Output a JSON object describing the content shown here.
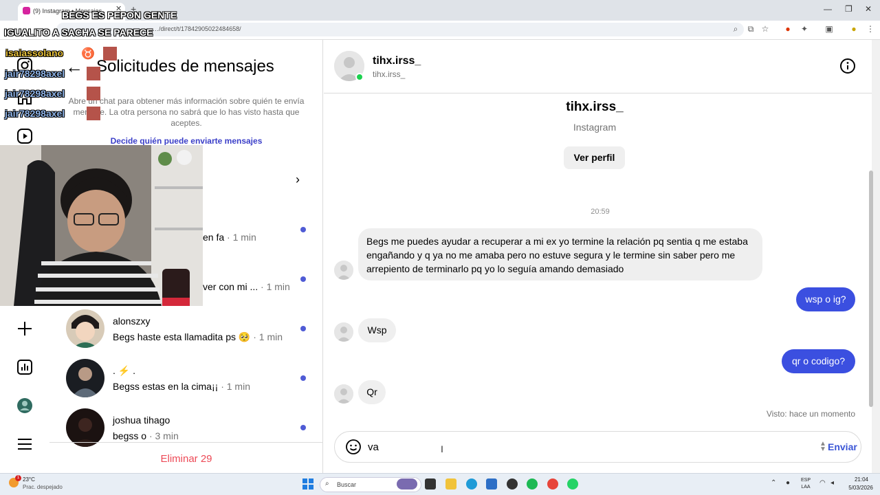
{
  "browser": {
    "tab_title": "(9) Instagram • Mensajes",
    "url": "…/direct/t/17842905022484658/"
  },
  "overlay": {
    "chat_line_1": "BEGS ES PEPON GENTE",
    "chat_line_2": "IGUALITO A SACHA SE PARECE",
    "chat_user_1": "isaiassolano",
    "chat_user_2": "jair78298axel",
    "chat_user_3": "jair78298axel",
    "chat_user_4": "jair78298axel"
  },
  "left_panel": {
    "title": "Solicitudes de mensajes",
    "info_text": "Abre un chat para obtener más información sobre quién te envía mensaje. La otra persona no sabrá que lo has visto hasta que aceptes.",
    "decide_link": "Decide quién puede enviarte mensajes",
    "partial_1": {
      "text": "en fa",
      "time": "· 1 min"
    },
    "partial_2": {
      "text": "ver con mi ...",
      "time": "· 1 min"
    },
    "requests": [
      {
        "username": "alonszxy",
        "preview": "Begs haste esta llamadita ps 🥺",
        "time": "· 1 min"
      },
      {
        "username": ". ⚡ .",
        "preview": "Begss estas en la cima¡¡",
        "time": "· 1 min"
      },
      {
        "username": "joshua tihago",
        "preview": "begss o",
        "time": "· 3 min"
      }
    ],
    "delete_label": "Eliminar 29"
  },
  "chat": {
    "header_name": "tihx.irss_",
    "header_user": "tihx.irss_",
    "profile_name": "tihx.irss_",
    "profile_sub": "Instagram",
    "view_profile": "Ver perfil",
    "timestamp": "20:59",
    "messages": [
      {
        "from": "them",
        "text": "Begs me puedes ayudar a recuperar a mi ex yo termine la relación pq sentia q me estaba engañando y q ya no me amaba pero no estuve segura y le termine sin saber pero me arrepiento de terminarlo pq yo lo seguía amando demasiado"
      },
      {
        "from": "me",
        "text": "wsp o ig?"
      },
      {
        "from": "them",
        "text": "Wsp"
      },
      {
        "from": "me",
        "text": "qr o codigo?"
      },
      {
        "from": "them",
        "text": "Qr"
      }
    ],
    "seen": "Visto: hace un momento",
    "input_value": "va ",
    "send_label": "Enviar"
  },
  "taskbar": {
    "temp": "23°C",
    "weather": "Prac. despejado",
    "search_placeholder": "Buscar",
    "lang_1": "ESP",
    "lang_2": "LAA",
    "clock_time": "21:04",
    "clock_date": "5/03/2026"
  },
  "colors": {
    "accent_blue": "#3b4fe0",
    "unread_dot": "#4f5bd5",
    "delete_red": "#ed4956",
    "online_green": "#1cd14f"
  }
}
